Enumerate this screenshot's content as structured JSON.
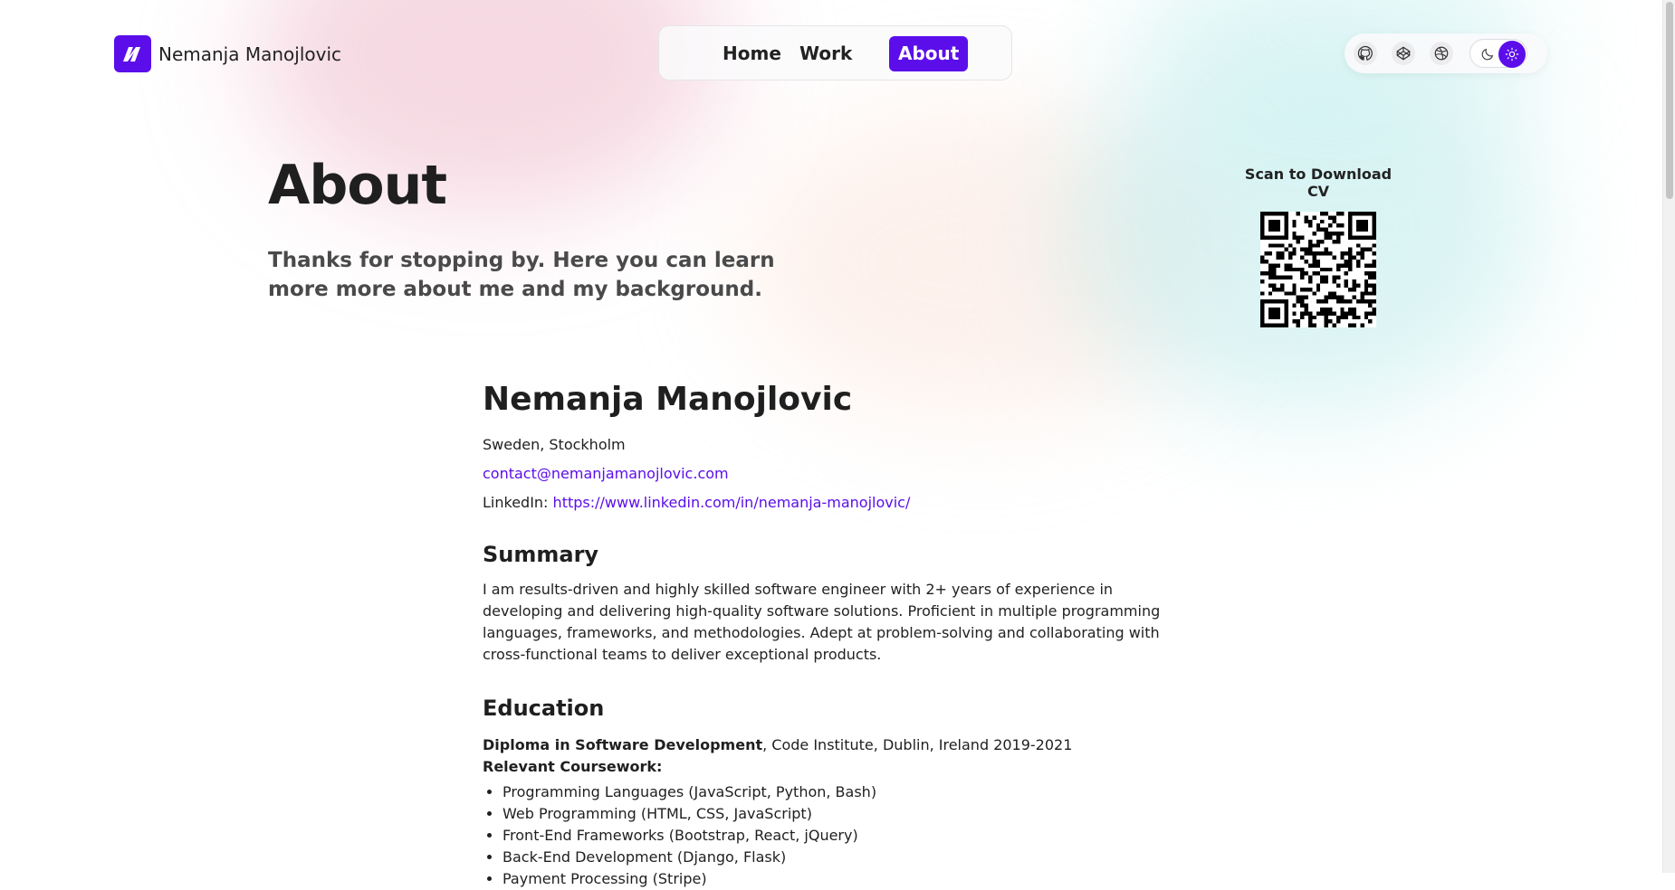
{
  "brand": {
    "name": "Nemanja Manojlovic",
    "logo_icon": "nm-logo-icon",
    "accent": "#5b0eea"
  },
  "nav": {
    "items": [
      {
        "label": "Home",
        "active": false
      },
      {
        "label": "Work",
        "active": false
      },
      {
        "label": "About",
        "active": true
      }
    ]
  },
  "tools": {
    "icons": [
      "github-icon",
      "codepen-icon",
      "dribbble-icon"
    ],
    "theme": {
      "dark_icon": "moon-icon",
      "light_icon": "sun-icon",
      "selected": "light"
    }
  },
  "page": {
    "title": "About",
    "subtitle": "Thanks for stopping by. Here you can learn more more about me and my background."
  },
  "qr": {
    "label": "Scan to Download CV"
  },
  "resume": {
    "name": "Nemanja Manojlovic",
    "location": "Sweden, Stockholm",
    "email": "contact@nemanjamanojlovic.com",
    "linkedin_label": "LinkedIn:",
    "linkedin_url": "https://www.linkedin.com/in/nemanja-manojlovic/",
    "summary_title": "Summary",
    "summary_text": "I am results-driven and highly skilled software engineer with 2+ years of experience in developing and delivering high-quality software solutions. Proficient in multiple programming languages, frameworks, and methodologies. Adept at problem-solving and collaborating with cross-functional teams to deliver exceptional products.",
    "education_title": "Education",
    "degree": "Diploma in Software Development",
    "degree_details": ", Code Institute, Dublin, Ireland 2019-2021",
    "coursework_label": "Relevant Coursework:",
    "coursework": [
      "Programming Languages (JavaScript, Python, Bash)",
      "Web Programming (HTML, CSS, JavaScript)",
      "Front-End Frameworks (Bootstrap, React, jQuery)",
      "Back-End Development (Django, Flask)",
      "Payment Processing (Stripe)"
    ]
  }
}
